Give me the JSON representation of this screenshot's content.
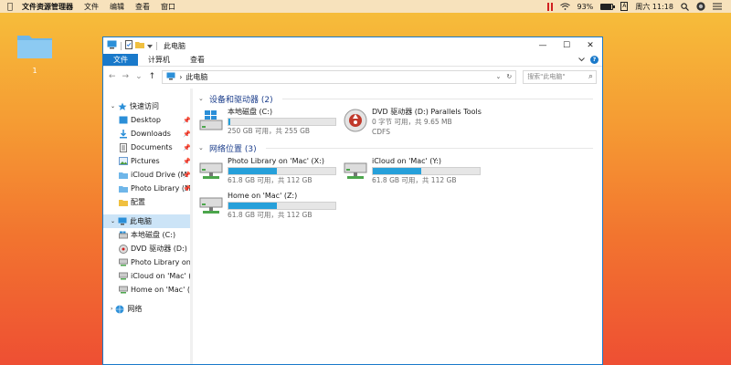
{
  "menubar": {
    "app_name": "文件资源管理器",
    "items": [
      "文件",
      "编辑",
      "查看",
      "窗口"
    ],
    "battery_percent": "93%",
    "ime_label": "A",
    "clock": "周六 11:18"
  },
  "desktop": {
    "folder_label": "1"
  },
  "window": {
    "title": "此电脑",
    "controls": [
      "—",
      "☐",
      "✕"
    ],
    "ribbon_tabs": [
      "文件",
      "计算机",
      "查看"
    ],
    "address": "此电脑",
    "search_placeholder": "搜索\"此电脑\""
  },
  "nav": {
    "quick_access": "快速访问",
    "pinned": [
      "Desktop",
      "Downloads",
      "Documents",
      "Pictures",
      "iCloud Drive (M",
      "Photo Library (M"
    ],
    "config": "配置",
    "this_pc": "此电脑",
    "pc_items": [
      "本地磁盘 (C:)",
      "DVD 驱动器 (D:) Pa",
      "Photo Library on 'M",
      "iCloud on 'Mac' (Y:",
      "Home on 'Mac' (Z:)"
    ],
    "network": "网络"
  },
  "content": {
    "devices_header": "设备和驱动器 (2)",
    "network_header": "网络位置 (3)",
    "devices": [
      {
        "name": "本地磁盘 (C:)",
        "detail": "250 GB 可用，共 255 GB",
        "fill": 0.02,
        "icon": "windows-drive-icon"
      },
      {
        "name": "DVD 驱动器 (D:) Parallels Tools",
        "detail": "0 字节 可用，共 9.65 MB",
        "extra": "CDFS",
        "icon": "dvd-icon"
      }
    ],
    "network_locations": [
      {
        "name": "Photo Library on 'Mac' (X:)",
        "detail": "61.8 GB 可用，共 112 GB",
        "fill": 0.45,
        "icon": "network-drive-icon"
      },
      {
        "name": "iCloud on 'Mac' (Y:)",
        "detail": "61.8 GB 可用，共 112 GB",
        "fill": 0.45,
        "icon": "network-drive-icon"
      },
      {
        "name": "Home on 'Mac' (Z:)",
        "detail": "61.8 GB 可用，共 112 GB",
        "fill": 0.45,
        "icon": "network-drive-icon"
      }
    ]
  },
  "colors": {
    "accent": "#1979ca",
    "bar_fill": "#26a0da"
  }
}
